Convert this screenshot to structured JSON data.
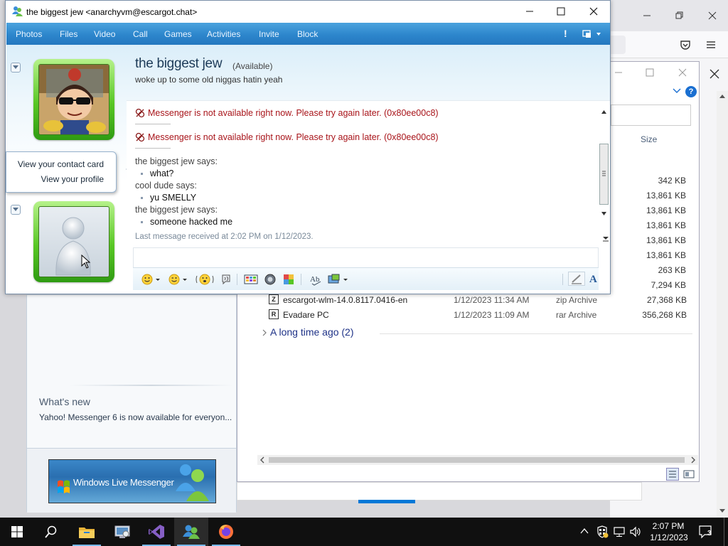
{
  "conversation": {
    "window_title": "the biggest jew <anarchyvm@escargot.chat>",
    "menu": [
      "Photos",
      "Files",
      "Video",
      "Call",
      "Games",
      "Activities",
      "Invite",
      "Block"
    ],
    "alert_glyph": "!",
    "contact": {
      "name": "the biggest jew",
      "status": "(Available)",
      "personal_message": "woke up to some old niggas hatin yeah"
    },
    "errors": [
      "Messenger is not available right now. Please try again later. (0x80ee00c8)",
      "Messenger is not available right now. Please try again later. (0x80ee00c8)"
    ],
    "messages": [
      {
        "speaker": "the biggest jew says:",
        "text": "what?"
      },
      {
        "speaker": "cool dude says:",
        "text": "yu SMELLY"
      },
      {
        "speaker": "the biggest jew says:",
        "text": "someone hacked me"
      }
    ],
    "last_received": "Last message received at 2:02 PM on 1/12/2023.",
    "input_value": "",
    "toolbar_icons": [
      "emoticon-icon",
      "wink-icon",
      "nudge-icon",
      "voice-clip-icon",
      "background-icon",
      "ink-icon",
      "game-icon",
      "spell-check-icon",
      "share-icon",
      "handwriting-icon",
      "font-icon"
    ],
    "font_glyph": "A"
  },
  "contact_popup": {
    "items": [
      "View your contact card",
      "View your profile"
    ]
  },
  "contact_list": {
    "whats_new_title": "What's new",
    "whats_new_text": "Yahoo! Messenger 6 is now available for everyon...",
    "banner_text": "Windows Live Messenger"
  },
  "explorer": {
    "size_header": "Size",
    "sizes": [
      "342 KB",
      "13,861 KB",
      "13,861 KB",
      "13,861 KB",
      "13,861 KB",
      "13,861 KB",
      "263 KB",
      "7,294 KB"
    ],
    "files": [
      {
        "name": "escargot-wlm-14.0.8117.0416-en",
        "date": "1/12/2023 11:34 AM",
        "type": "zip Archive",
        "size": "27,368 KB",
        "badge": "Z"
      },
      {
        "name": "Evadare PC",
        "date": "1/12/2023 11:09 AM",
        "type": "rar Archive",
        "size": "356,268 KB",
        "badge": "R"
      }
    ],
    "group_label": "A long time ago (2)",
    "help_glyph": "?"
  },
  "taskbar": {
    "apps": [
      "start-button",
      "search-icon",
      "file-explorer-icon",
      "control-panel-icon",
      "visual-studio-icon",
      "messenger-icon",
      "firefox-icon"
    ],
    "clock_time": "2:07 PM",
    "clock_date": "1/12/2023",
    "notification_count": "3"
  },
  "colors": {
    "menubar": "#2d86cc",
    "error_text": "#a8141a",
    "avatar_frame": "#58c724",
    "taskbar": "#101010",
    "accent": "#0078d7"
  }
}
